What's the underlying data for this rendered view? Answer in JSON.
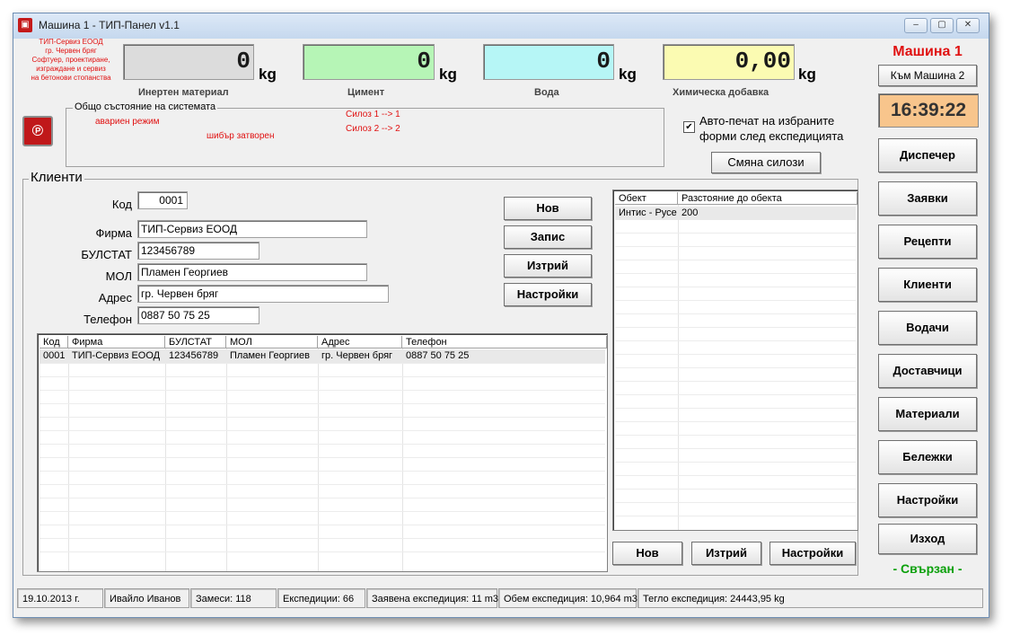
{
  "window": {
    "title": "Машина 1 - ТИП-Панел v1.1",
    "controls": {
      "minimize": "‒",
      "maximize": "▢",
      "close": "✕"
    }
  },
  "company": {
    "lines": [
      "ТИП-Сервиз ЕООД",
      "гр. Червен бряг",
      "Софтуер, проектиране,",
      "изграждане и сервиз",
      "на бетонови стопанства"
    ]
  },
  "gauges": [
    {
      "value": "0",
      "unit": "kg",
      "label": "Инертен материал",
      "color": "#dcdcdc"
    },
    {
      "value": "0",
      "unit": "kg",
      "label": "Цимент",
      "color": "#b6f5b6"
    },
    {
      "value": "0",
      "unit": "kg",
      "label": "Вода",
      "color": "#b6f6f6"
    },
    {
      "value": "0,00",
      "unit": "kg",
      "label": "Химическа добавка",
      "color": "#fbfbb2"
    }
  ],
  "machine": {
    "name": "Машина 1",
    "switch_label": "Към Машина 2",
    "clock": "16:39:22",
    "connection": "- Свързан -"
  },
  "system_state": {
    "title": "Общо състояние на системата",
    "emergency": "авариен режим",
    "gate": "шибър затворен",
    "silo1": "Силоз 1 -->   1",
    "silo2": "Силоз 2 -->   2"
  },
  "autoprint": {
    "checked": true,
    "line1": "Авто-печат на избраните",
    "line2": "форми след експедицията"
  },
  "swap_silos_label": "Смяна силози",
  "clients": {
    "title": "Клиенти",
    "fields": {
      "kod": {
        "label": "Код",
        "value": "0001"
      },
      "firma": {
        "label": "Фирма",
        "value": "ТИП-Сервиз ЕООД"
      },
      "bulstat": {
        "label": "БУЛСТАТ",
        "value": "123456789"
      },
      "mol": {
        "label": "МОЛ",
        "value": "Пламен Георгиев"
      },
      "adres": {
        "label": "Адрес",
        "value": "гр. Червен бряг"
      },
      "telefon": {
        "label": "Телефон",
        "value": "0887 50 75 25"
      }
    },
    "buttons": {
      "new": "Нов",
      "save": "Запис",
      "delete": "Изтрий",
      "settings": "Настройки"
    },
    "table": {
      "columns": [
        "Код",
        "Фирма",
        "БУЛСТАТ",
        "МОЛ",
        "Адрес",
        "Телефон"
      ],
      "rows": [
        [
          "0001",
          "ТИП-Сервиз ЕООД",
          "123456789",
          "Пламен Георгиев",
          "гр. Червен бряг",
          "0887 50 75 25"
        ]
      ]
    }
  },
  "objects": {
    "columns": [
      "Обект",
      "Разстояние до обекта"
    ],
    "rows": [
      [
        "Интис - Русе",
        "200"
      ]
    ],
    "buttons": {
      "new": "Нов",
      "delete": "Изтрий",
      "settings": "Настройки"
    }
  },
  "sidebar": {
    "items": [
      "Диспечер",
      "Заявки",
      "Рецепти",
      "Клиенти",
      "Водачи",
      "Доставчици",
      "Материали",
      "Бележки",
      "Настройки"
    ],
    "exit": "Изход"
  },
  "statusbar": {
    "date": "19.10.2013 г.",
    "user": "Ивайло Иванов",
    "batches": "Замеси: 118",
    "expeditions": "Експедиции: 66",
    "requested": "Заявена експедиция: 11 m3",
    "volume": "Обем експедиция: 10,964 m3",
    "weight": "Тегло експедиция: 24443,95 kg"
  }
}
